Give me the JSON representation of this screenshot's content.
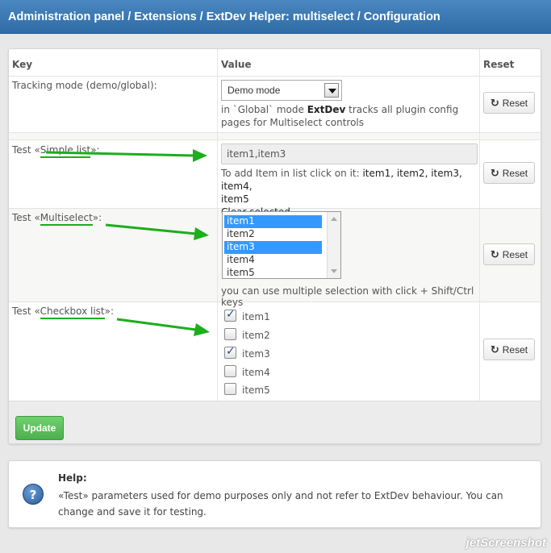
{
  "header": {
    "title": "Administration panel / Extensions / ExtDev Helper: multiselect / Configuration"
  },
  "table": {
    "columns": {
      "key": "Key",
      "value": "Value",
      "reset": "Reset"
    },
    "reset_label": "Reset",
    "tracking": {
      "key": "Tracking mode (demo/global):",
      "selected": "Demo mode",
      "desc_pre": "in `Global` mode ",
      "desc_bold": "ExtDev",
      "desc_post": " tracks all plugin config pages for Multiselect controls"
    },
    "simple_list": {
      "key_pre": "Test «",
      "key_name": "Simple list",
      "key_post": "»:",
      "value": "item1,item3",
      "hint_pre": "To add Item in list click on it: ",
      "items_line": "item1, item2, item3, item4,",
      "items_tail": "item5",
      "clear": "Clear selected"
    },
    "multiselect": {
      "key_pre": "Test «",
      "key_name": "Multiselect",
      "key_post": "»:",
      "options": [
        {
          "label": "item1",
          "selected": true
        },
        {
          "label": "item2",
          "selected": false
        },
        {
          "label": "item3",
          "selected": true
        },
        {
          "label": "item4",
          "selected": false
        },
        {
          "label": "item5",
          "selected": false
        }
      ],
      "hint": "you can use multiple selection with click + Shift/Ctrl keys"
    },
    "checkbox_list": {
      "key_pre": "Test «",
      "key_name": "Checkbox list",
      "key_post": "»:",
      "items": [
        {
          "label": "item1",
          "checked": true
        },
        {
          "label": "item2",
          "checked": false
        },
        {
          "label": "item3",
          "checked": true
        },
        {
          "label": "item4",
          "checked": false
        },
        {
          "label": "item5",
          "checked": false
        }
      ]
    }
  },
  "footer": {
    "update_label": "Update"
  },
  "help": {
    "title": "Help:",
    "text": "«Test» parameters used for demo purposes only and not refer to ExtDev behaviour. You can change and save it for testing."
  },
  "watermark": "jetScreenshot",
  "colors": {
    "header": "#3c7ab5",
    "arrow": "#1dad1d",
    "update": "#5cbf5c",
    "selection": "#3399ff"
  }
}
